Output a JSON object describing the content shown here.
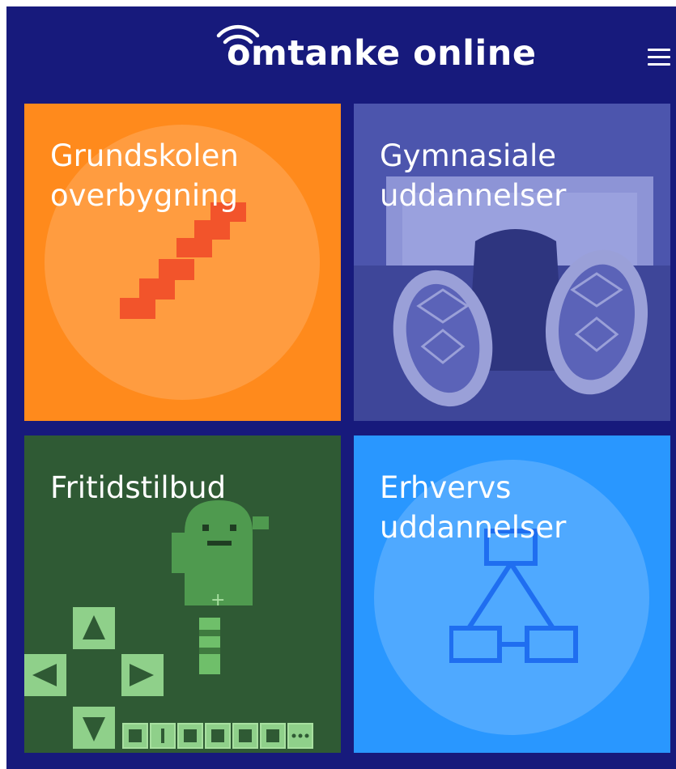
{
  "header": {
    "logo_text": "omtanke online",
    "menu_icon": "hamburger-menu-icon"
  },
  "tiles": [
    {
      "label": "Grundskolen\noverbygning",
      "icon": "staircase-icon",
      "color": "#ff8a1c"
    },
    {
      "label": "Gymnasiale\nuddannelser",
      "icon": "sneakers-photo",
      "color": "#4f58b0"
    },
    {
      "label": "Fritidstilbud",
      "icon": "pixel-game-image",
      "color": "#2f5a34"
    },
    {
      "label": "Erhvervs\nuddannelser",
      "icon": "flowchart-icon",
      "color": "#2997ff"
    }
  ],
  "colors": {
    "background": "#171a7c",
    "accent_orange": "#ff8a1c",
    "accent_blue": "#2997ff"
  }
}
